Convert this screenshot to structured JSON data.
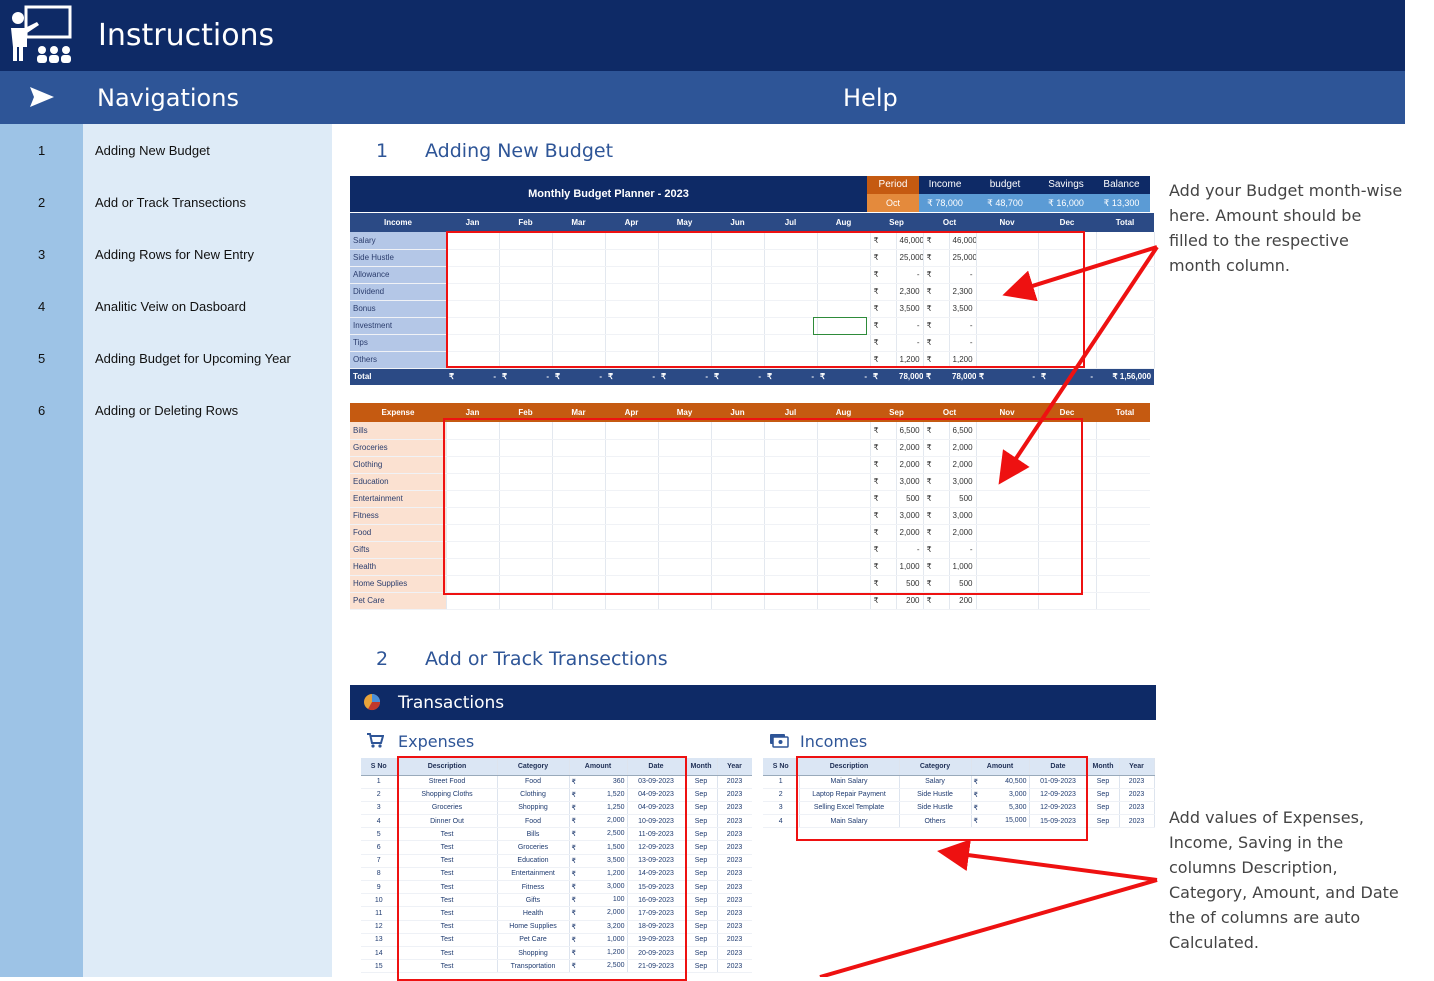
{
  "header": {
    "title": "Instructions",
    "nav_heading": "Navigations",
    "help_heading": "Help"
  },
  "nav": [
    {
      "num": "1",
      "label": "Adding New Budget"
    },
    {
      "num": "2",
      "label": "Add or Track Transections"
    },
    {
      "num": "3",
      "label": "Adding Rows for New Entry"
    },
    {
      "num": "4",
      "label": "Analitic Veiw on Dasboard"
    },
    {
      "num": "5",
      "label": "Adding Budget for Upcoming Year"
    },
    {
      "num": "6",
      "label": "Adding or Deleting Rows"
    }
  ],
  "sections": [
    {
      "num": "1",
      "title": "Adding New Budget"
    },
    {
      "num": "2",
      "title": "Add or Track Transections"
    }
  ],
  "notes": {
    "budget": "Add your Budget month-wise here. Amount should be filled to the respective month column.",
    "transactions": "Add values of Expenses, Income, Saving in the columns Description, Category, Amount, and Date the of columns are auto Calculated."
  },
  "budget": {
    "title": "Monthly Budget Planner - 2023",
    "summary_labels": [
      "Period",
      "Income",
      "budget",
      "Savings",
      "Balance"
    ],
    "summary_values": [
      "Oct",
      "₹ 78,000",
      "₹ 48,700",
      "₹ 16,000",
      "₹ 13,300"
    ],
    "months": [
      "Jan",
      "Feb",
      "Mar",
      "Apr",
      "May",
      "Jun",
      "Jul",
      "Aug",
      "Sep",
      "Oct",
      "Nov",
      "Dec",
      "Total"
    ],
    "income_header": "Income",
    "income_rows": [
      {
        "label": "Salary",
        "sep": "46,000",
        "oct": "46,000"
      },
      {
        "label": "Side Hustle",
        "sep": "25,000",
        "oct": "25,000"
      },
      {
        "label": "Allowance",
        "sep": "-",
        "oct": "-"
      },
      {
        "label": "Dividend",
        "sep": "2,300",
        "oct": "2,300"
      },
      {
        "label": "Bonus",
        "sep": "3,500",
        "oct": "3,500"
      },
      {
        "label": "Investment",
        "sep": "-",
        "oct": "-"
      },
      {
        "label": "Tips",
        "sep": "-",
        "oct": "-"
      },
      {
        "label": "Others",
        "sep": "1,200",
        "oct": "1,200"
      }
    ],
    "total_label": "Total",
    "total_sep": "78,000",
    "total_oct": "78,000",
    "total_year": "1,56,000",
    "currency": "₹",
    "dash": "-",
    "expense_header": "Expense",
    "expense_rows": [
      {
        "label": "Bills",
        "sep": "6,500",
        "oct": "6,500"
      },
      {
        "label": "Groceries",
        "sep": "2,000",
        "oct": "2,000"
      },
      {
        "label": "Clothing",
        "sep": "2,000",
        "oct": "2,000"
      },
      {
        "label": "Education",
        "sep": "3,000",
        "oct": "3,000"
      },
      {
        "label": "Entertainment",
        "sep": "500",
        "oct": "500"
      },
      {
        "label": "Fitness",
        "sep": "3,000",
        "oct": "3,000"
      },
      {
        "label": "Food",
        "sep": "2,000",
        "oct": "2,000"
      },
      {
        "label": "Gifts",
        "sep": "-",
        "oct": "-"
      },
      {
        "label": "Health",
        "sep": "1,000",
        "oct": "1,000"
      },
      {
        "label": "Home Supplies",
        "sep": "500",
        "oct": "500"
      },
      {
        "label": "Pet Care",
        "sep": "200",
        "oct": "200"
      }
    ]
  },
  "transactions": {
    "title": "Transactions",
    "expenses_title": "Expenses",
    "incomes_title": "Incomes",
    "columns": [
      "S No",
      "Description",
      "Category",
      "Amount",
      "Date",
      "Month",
      "Year"
    ],
    "expenses": [
      [
        "1",
        "Street Food",
        "Food",
        "360",
        "03-09-2023",
        "Sep",
        "2023"
      ],
      [
        "2",
        "Shopping Cloths",
        "Clothing",
        "1,520",
        "04-09-2023",
        "Sep",
        "2023"
      ],
      [
        "3",
        "Groceries",
        "Shopping",
        "1,250",
        "04-09-2023",
        "Sep",
        "2023"
      ],
      [
        "4",
        "Dinner Out",
        "Food",
        "2,000",
        "10-09-2023",
        "Sep",
        "2023"
      ],
      [
        "5",
        "Test",
        "Bills",
        "2,500",
        "11-09-2023",
        "Sep",
        "2023"
      ],
      [
        "6",
        "Test",
        "Groceries",
        "1,500",
        "12-09-2023",
        "Sep",
        "2023"
      ],
      [
        "7",
        "Test",
        "Education",
        "3,500",
        "13-09-2023",
        "Sep",
        "2023"
      ],
      [
        "8",
        "Test",
        "Entertainment",
        "1,200",
        "14-09-2023",
        "Sep",
        "2023"
      ],
      [
        "9",
        "Test",
        "Fitness",
        "3,000",
        "15-09-2023",
        "Sep",
        "2023"
      ],
      [
        "10",
        "Test",
        "Gifts",
        "100",
        "16-09-2023",
        "Sep",
        "2023"
      ],
      [
        "11",
        "Test",
        "Health",
        "2,000",
        "17-09-2023",
        "Sep",
        "2023"
      ],
      [
        "12",
        "Test",
        "Home Supplies",
        "3,200",
        "18-09-2023",
        "Sep",
        "2023"
      ],
      [
        "13",
        "Test",
        "Pet Care",
        "1,000",
        "19-09-2023",
        "Sep",
        "2023"
      ],
      [
        "14",
        "Test",
        "Shopping",
        "1,200",
        "20-09-2023",
        "Sep",
        "2023"
      ],
      [
        "15",
        "Test",
        "Transportation",
        "2,500",
        "21-09-2023",
        "Sep",
        "2023"
      ]
    ],
    "incomes": [
      [
        "1",
        "Main Salary",
        "Salary",
        "40,500",
        "01-09-2023",
        "Sep",
        "2023"
      ],
      [
        "2",
        "Laptop Repair Payment",
        "Side Hustle",
        "3,000",
        "12-09-2023",
        "Sep",
        "2023"
      ],
      [
        "3",
        "Selling Excel Template",
        "Side Hustle",
        "5,300",
        "12-09-2023",
        "Sep",
        "2023"
      ],
      [
        "4",
        "Main Salary",
        "Others",
        "15,000",
        "15-09-2023",
        "Sep",
        "2023"
      ]
    ]
  },
  "colors": {
    "title_bar": "#0e2a66",
    "nav_bar": "#2e5597",
    "sidebar_num": "#9dc3e6",
    "sidebar_lbl": "#deebf7",
    "expense_accent": "#c55a11",
    "highlight": "#ee1111"
  }
}
